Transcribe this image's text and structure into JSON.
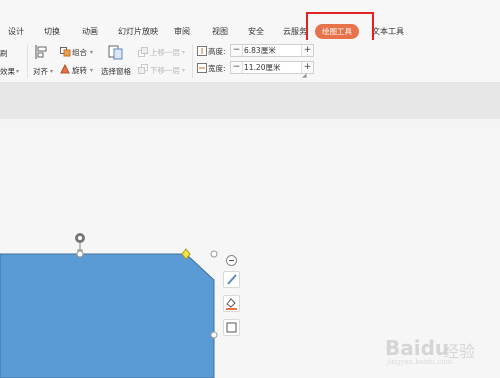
{
  "tabs": [
    {
      "label": "设计",
      "active": false
    },
    {
      "label": "切换",
      "active": false
    },
    {
      "label": "动画",
      "active": false
    },
    {
      "label": "幻灯片放映",
      "active": false
    },
    {
      "label": "审阅",
      "active": false
    },
    {
      "label": "视图",
      "active": false
    },
    {
      "label": "安全",
      "active": false
    },
    {
      "label": "云服务",
      "active": false
    },
    {
      "label": "绘图工具",
      "active": true
    },
    {
      "label": "文本工具",
      "active": false
    }
  ],
  "ribbon": {
    "fill_partial": "刷",
    "effect_partial": "效果",
    "align_label": "对齐",
    "group_label": "组合",
    "rotate_label": "旋转",
    "selection_pane_label": "选择窗格",
    "bring_forward_label": "上移一层",
    "send_backward_label": "下移一层",
    "height_label": "高度:",
    "height_value": "6.83厘米",
    "width_label": "宽度:",
    "width_value": "11.20厘米",
    "minus": "−",
    "plus": "+"
  },
  "colors": {
    "accent_tab": "#e8734a",
    "highlight_box": "#e32322",
    "shape_fill": "#5b9bd5",
    "shape_stroke": "#41719c"
  },
  "icons": [
    "align-icon",
    "group-icon",
    "rotate-icon",
    "selection-pane-icon",
    "bring-forward-icon",
    "send-backward-icon",
    "height-icon",
    "width-icon",
    "zoom-out-icon",
    "pen-style-icon",
    "fill-bucket-icon",
    "shape-frame-icon"
  ],
  "watermark": {
    "brand": "Baidu",
    "text": "经验",
    "url": "jingyan.baidu.com"
  }
}
